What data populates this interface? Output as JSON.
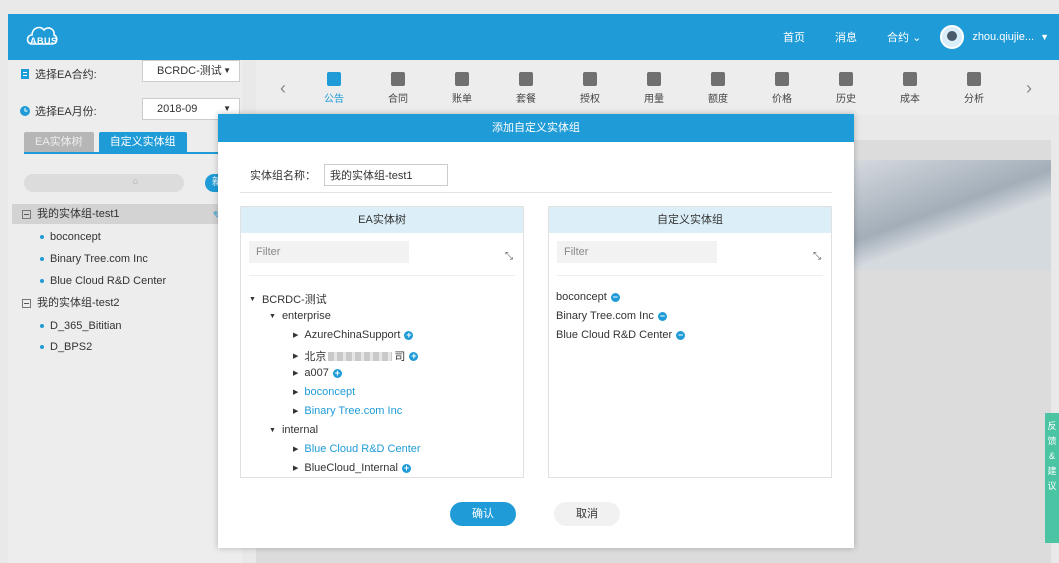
{
  "app": {
    "logo_text": "ABUS"
  },
  "topnav": {
    "home": "首页",
    "messages": "消息",
    "contracts": "合约 ⌄",
    "user": "zhou.qiujie..."
  },
  "left": {
    "ea_contract_label": "选择EA合约:",
    "ea_contract_value": "BCRDC-测试",
    "ea_month_label": "选择EA月份:",
    "ea_month_value": "2018-09",
    "tabs": [
      "EA实体树",
      "自定义实体组"
    ],
    "new_button": "新",
    "tree": [
      {
        "label": "我的实体组-test1",
        "level": 0
      },
      {
        "label": "boconcept",
        "level": 1
      },
      {
        "label": "Binary Tree.com Inc",
        "level": 1
      },
      {
        "label": "Blue Cloud R&D Center",
        "level": 1
      },
      {
        "label": "我的实体组-test2",
        "level": 0
      },
      {
        "label": "D_365_Bititian",
        "level": 1
      },
      {
        "label": "D_BPS2",
        "level": 1
      }
    ]
  },
  "toolbar": {
    "items": [
      "公告",
      "合同",
      "账单",
      "套餐",
      "授权",
      "用量",
      "额度",
      "价格",
      "历史",
      "成本",
      "分析"
    ],
    "active": "公告"
  },
  "feedback": "反馈&建议",
  "modal": {
    "title": "添加自定义实体组",
    "name_label": "实体组名称：",
    "name_value": "我的实体组-test1",
    "left_pane_title": "EA实体树",
    "right_pane_title": "自定义实体组",
    "filter_placeholder": "Filter",
    "left_tree": {
      "root": "BCRDC-测试",
      "enterprise": "enterprise",
      "enterprise_children": [
        "AzureChinaSupport",
        "北京",
        "司",
        "a007",
        "boconcept",
        "Binary Tree.com Inc"
      ],
      "internal": "internal",
      "internal_children": [
        "Blue Cloud R&D Center",
        "BlueCloud_Internal"
      ]
    },
    "right_items": [
      "boconcept",
      "Binary Tree.com Inc",
      "Blue Cloud R&D Center"
    ],
    "confirm": "确认",
    "cancel": "取消"
  }
}
